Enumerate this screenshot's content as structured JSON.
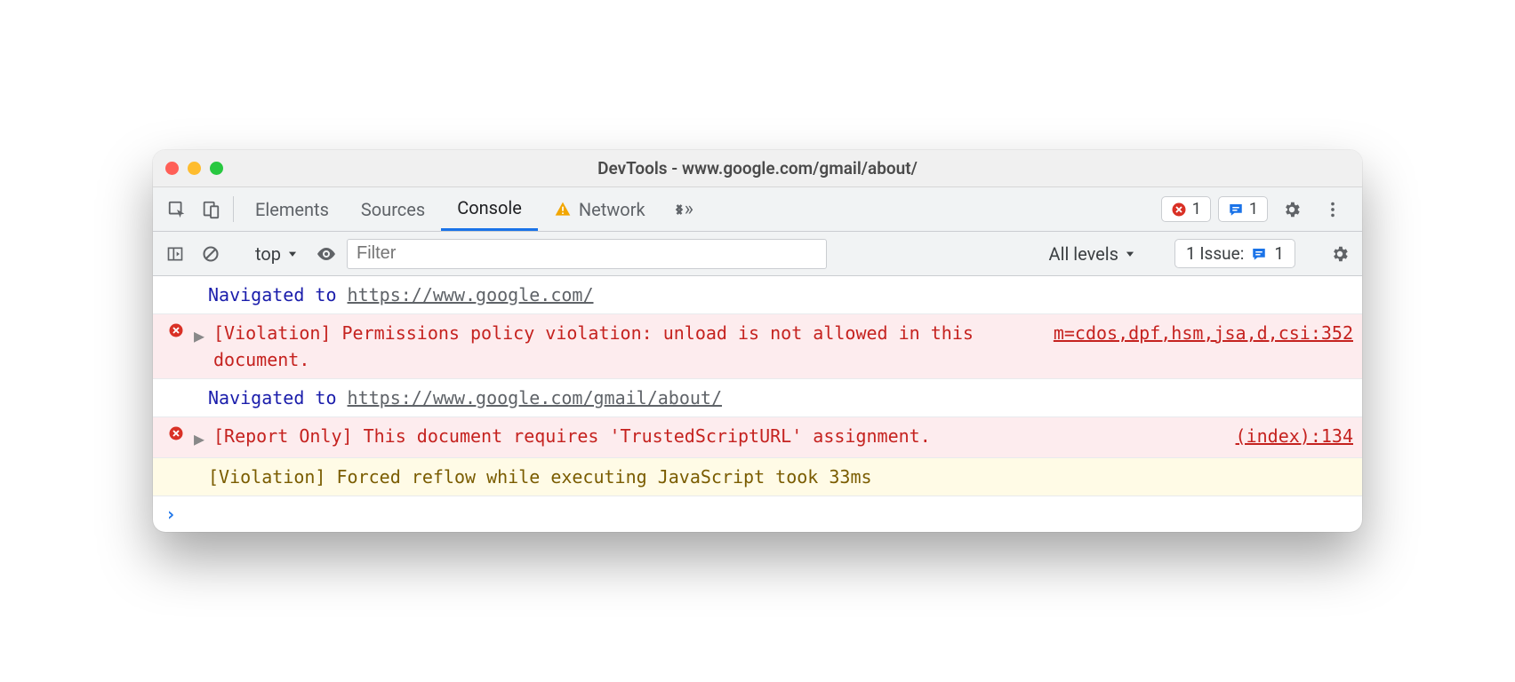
{
  "window": {
    "title": "DevTools - www.google.com/gmail/about/"
  },
  "tabs": {
    "items": [
      "Elements",
      "Sources",
      "Console",
      "Network"
    ],
    "active": "Console"
  },
  "badges": {
    "errors": "1",
    "issues": "1"
  },
  "toolbar": {
    "context": "top",
    "filter_placeholder": "Filter",
    "levels": "All levels",
    "issue_label": "1 Issue:",
    "issue_count": "1"
  },
  "messages": {
    "nav1_prefix": "Navigated to ",
    "nav1_url": "https://www.google.com/",
    "err1_text": "[Violation] Permissions policy violation: unload is not allowed in this document.",
    "err1_src": "m=cdos,dpf,hsm,jsa,d,csi:352",
    "nav2_prefix": "Navigated to ",
    "nav2_url": "https://www.google.com/gmail/about/",
    "err2_text": "[Report Only] This document requires 'TrustedScriptURL' assignment.",
    "err2_src": "(index):134",
    "warn1_text": "[Violation] Forced reflow while executing JavaScript took 33ms"
  }
}
